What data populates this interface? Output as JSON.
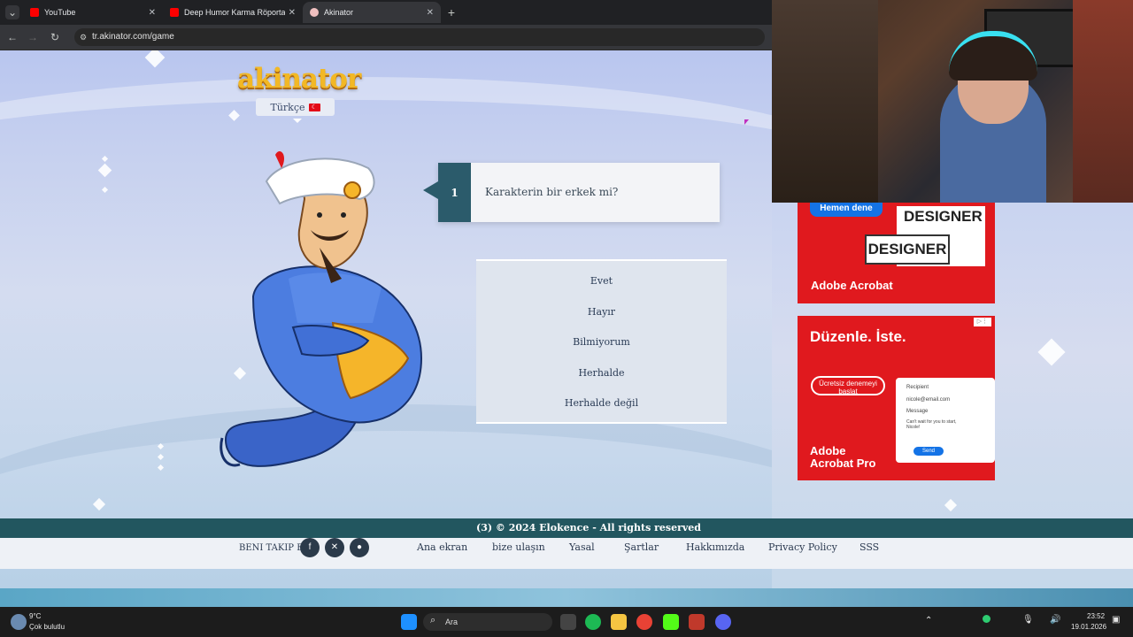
{
  "browser": {
    "tabs": [
      {
        "label": "YouTube",
        "color": "#ff0000"
      },
      {
        "label": "Deep Humor Karma Röportaj Sa",
        "color": "#ff0000"
      },
      {
        "label": "Akinator",
        "color": "#e8eaed"
      }
    ],
    "url": "tr.akinator.com/game"
  },
  "akinator": {
    "logo": "akinator",
    "language": "Türkçe",
    "question": {
      "number": "1",
      "text": "Karakterin bir erkek mi?"
    },
    "answers": [
      "Evet",
      "Hayır",
      "Bilmiyorum",
      "Herhalde",
      "Herhalde değil"
    ],
    "footer": {
      "follow_label": "BENI TAKIP ET",
      "links": [
        "Ana ekran",
        "bize ulaşın",
        "Yasal",
        "Şartlar",
        "Hakkımızda",
        "Privacy Policy",
        "SSS"
      ],
      "copyright": "(3)  © 2024 Elokence - All rights reserved"
    }
  },
  "ads": {
    "ad1": {
      "cta": "Hemen dene",
      "word": "DESIGNER",
      "brand": "Adobe Acrobat"
    },
    "ad2": {
      "headline": "Düzenle. İste.",
      "cta": "Ücretsiz denemeyi başlat",
      "brand": "Adobe Acrobat Pro",
      "form": {
        "recipient": "Recipient",
        "email": "nicole@email.com",
        "message": "Message",
        "body": "Can't wait for you to start, Nicole!",
        "send": "Send"
      }
    }
  },
  "taskbar": {
    "weather_temp": "9°C",
    "weather_desc": "Çok bulutlu",
    "search": "Ara",
    "time": "23:52",
    "date": "19.01.2026"
  }
}
